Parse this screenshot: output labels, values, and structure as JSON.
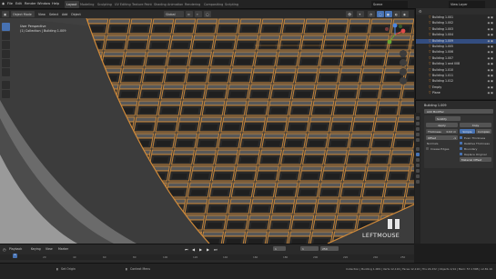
{
  "app": {
    "menus": [
      "File",
      "Edit",
      "Render",
      "Window",
      "Help"
    ],
    "workspaces": [
      "Layout",
      "Modeling",
      "Sculpting",
      "UV Editing",
      "Texture Paint",
      "Shading",
      "Animation",
      "Rendering",
      "Compositing",
      "Scripting"
    ],
    "active_workspace": "Layout",
    "scene_label": "Scene",
    "view_layer_label": "View Layer"
  },
  "viewport_header": {
    "mode": "Object Mode",
    "view": "View",
    "select": "Select",
    "add": "Add",
    "object": "Object",
    "orientation": "Global"
  },
  "viewport": {
    "info_line1": "User Perspective",
    "info_line2": "(1) Collection | Building 1.009"
  },
  "watermark": {
    "text": "LEFTMOUSE"
  },
  "outliner": {
    "rows": [
      {
        "label": "Building 1.001",
        "selected": false
      },
      {
        "label": "Building 1.002",
        "selected": false
      },
      {
        "label": "Building 1.003",
        "selected": false
      },
      {
        "label": "Building 1.004",
        "selected": false
      },
      {
        "label": "Building 1.009",
        "selected": true
      },
      {
        "label": "Building 1.005",
        "selected": false
      },
      {
        "label": "Building 1.006",
        "selected": false
      },
      {
        "label": "Building 1.007",
        "selected": false
      },
      {
        "label": "Building 1 and 008",
        "selected": false
      },
      {
        "label": "Building 1.010",
        "selected": false
      },
      {
        "label": "Building 1.011",
        "selected": false
      },
      {
        "label": "Building 1.012",
        "selected": false
      },
      {
        "label": "Empty",
        "selected": false
      },
      {
        "label": "Plane",
        "selected": false
      }
    ]
  },
  "properties": {
    "object_name": "Building 1.009",
    "add_modifier": "Add Modifier",
    "modifier_name": "Solidify",
    "apply": "Apply",
    "copy": "Copy",
    "thickness_label": "Thickness",
    "thickness_value": "0.02 m",
    "offset_label": "Offset",
    "offset_value": "-1",
    "mode_simple": "Simple",
    "mode_complex": "Complex",
    "even_thickness": "Even Thickness",
    "relative_thickness": "Relative Thickness",
    "boundary": "Boundary",
    "replace_original": "Replace Original",
    "normals": "Normals",
    "crease_edges": "Crease Edges",
    "material_offset": "Material Offset"
  },
  "timeline": {
    "menus": [
      "Playback",
      "Keying",
      "View",
      "Marker"
    ],
    "current_frame": "1",
    "start": "1",
    "end": "250",
    "ticks": [
      "0",
      "20",
      "40",
      "60",
      "80",
      "100",
      "120",
      "140",
      "160",
      "180",
      "200",
      "220",
      "240",
      "250"
    ]
  },
  "statusbar": {
    "left": "Set Origin",
    "mid": "Context Menu",
    "right": "Collection | Building 1.009 | Verts 12,116 | Faces 12,116 | Tris 24,232 | Objects 1/14 | Mem: 57.1 MiB | v2.81.16"
  },
  "colors": {
    "accent": "#4772b3",
    "selection_outline": "#e28a2e",
    "viewport_bg": "#3a3a3a"
  }
}
